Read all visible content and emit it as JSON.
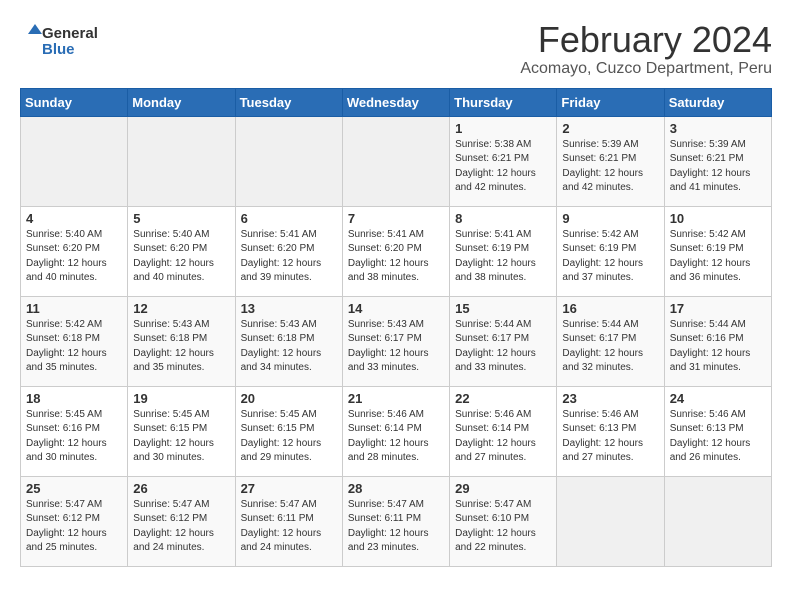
{
  "header": {
    "logo_general": "General",
    "logo_blue": "Blue",
    "title": "February 2024",
    "subtitle": "Acomayo, Cuzco Department, Peru"
  },
  "weekdays": [
    "Sunday",
    "Monday",
    "Tuesday",
    "Wednesday",
    "Thursday",
    "Friday",
    "Saturday"
  ],
  "weeks": [
    [
      {
        "day": "",
        "sunrise": "",
        "sunset": "",
        "daylight": ""
      },
      {
        "day": "",
        "sunrise": "",
        "sunset": "",
        "daylight": ""
      },
      {
        "day": "",
        "sunrise": "",
        "sunset": "",
        "daylight": ""
      },
      {
        "day": "",
        "sunrise": "",
        "sunset": "",
        "daylight": ""
      },
      {
        "day": "1",
        "sunrise": "5:38 AM",
        "sunset": "6:21 PM",
        "daylight": "12 hours and 42 minutes."
      },
      {
        "day": "2",
        "sunrise": "5:39 AM",
        "sunset": "6:21 PM",
        "daylight": "12 hours and 42 minutes."
      },
      {
        "day": "3",
        "sunrise": "5:39 AM",
        "sunset": "6:21 PM",
        "daylight": "12 hours and 41 minutes."
      }
    ],
    [
      {
        "day": "4",
        "sunrise": "5:40 AM",
        "sunset": "6:20 PM",
        "daylight": "12 hours and 40 minutes."
      },
      {
        "day": "5",
        "sunrise": "5:40 AM",
        "sunset": "6:20 PM",
        "daylight": "12 hours and 40 minutes."
      },
      {
        "day": "6",
        "sunrise": "5:41 AM",
        "sunset": "6:20 PM",
        "daylight": "12 hours and 39 minutes."
      },
      {
        "day": "7",
        "sunrise": "5:41 AM",
        "sunset": "6:20 PM",
        "daylight": "12 hours and 38 minutes."
      },
      {
        "day": "8",
        "sunrise": "5:41 AM",
        "sunset": "6:19 PM",
        "daylight": "12 hours and 38 minutes."
      },
      {
        "day": "9",
        "sunrise": "5:42 AM",
        "sunset": "6:19 PM",
        "daylight": "12 hours and 37 minutes."
      },
      {
        "day": "10",
        "sunrise": "5:42 AM",
        "sunset": "6:19 PM",
        "daylight": "12 hours and 36 minutes."
      }
    ],
    [
      {
        "day": "11",
        "sunrise": "5:42 AM",
        "sunset": "6:18 PM",
        "daylight": "12 hours and 35 minutes."
      },
      {
        "day": "12",
        "sunrise": "5:43 AM",
        "sunset": "6:18 PM",
        "daylight": "12 hours and 35 minutes."
      },
      {
        "day": "13",
        "sunrise": "5:43 AM",
        "sunset": "6:18 PM",
        "daylight": "12 hours and 34 minutes."
      },
      {
        "day": "14",
        "sunrise": "5:43 AM",
        "sunset": "6:17 PM",
        "daylight": "12 hours and 33 minutes."
      },
      {
        "day": "15",
        "sunrise": "5:44 AM",
        "sunset": "6:17 PM",
        "daylight": "12 hours and 33 minutes."
      },
      {
        "day": "16",
        "sunrise": "5:44 AM",
        "sunset": "6:17 PM",
        "daylight": "12 hours and 32 minutes."
      },
      {
        "day": "17",
        "sunrise": "5:44 AM",
        "sunset": "6:16 PM",
        "daylight": "12 hours and 31 minutes."
      }
    ],
    [
      {
        "day": "18",
        "sunrise": "5:45 AM",
        "sunset": "6:16 PM",
        "daylight": "12 hours and 30 minutes."
      },
      {
        "day": "19",
        "sunrise": "5:45 AM",
        "sunset": "6:15 PM",
        "daylight": "12 hours and 30 minutes."
      },
      {
        "day": "20",
        "sunrise": "5:45 AM",
        "sunset": "6:15 PM",
        "daylight": "12 hours and 29 minutes."
      },
      {
        "day": "21",
        "sunrise": "5:46 AM",
        "sunset": "6:14 PM",
        "daylight": "12 hours and 28 minutes."
      },
      {
        "day": "22",
        "sunrise": "5:46 AM",
        "sunset": "6:14 PM",
        "daylight": "12 hours and 27 minutes."
      },
      {
        "day": "23",
        "sunrise": "5:46 AM",
        "sunset": "6:13 PM",
        "daylight": "12 hours and 27 minutes."
      },
      {
        "day": "24",
        "sunrise": "5:46 AM",
        "sunset": "6:13 PM",
        "daylight": "12 hours and 26 minutes."
      }
    ],
    [
      {
        "day": "25",
        "sunrise": "5:47 AM",
        "sunset": "6:12 PM",
        "daylight": "12 hours and 25 minutes."
      },
      {
        "day": "26",
        "sunrise": "5:47 AM",
        "sunset": "6:12 PM",
        "daylight": "12 hours and 24 minutes."
      },
      {
        "day": "27",
        "sunrise": "5:47 AM",
        "sunset": "6:11 PM",
        "daylight": "12 hours and 24 minutes."
      },
      {
        "day": "28",
        "sunrise": "5:47 AM",
        "sunset": "6:11 PM",
        "daylight": "12 hours and 23 minutes."
      },
      {
        "day": "29",
        "sunrise": "5:47 AM",
        "sunset": "6:10 PM",
        "daylight": "12 hours and 22 minutes."
      },
      {
        "day": "",
        "sunrise": "",
        "sunset": "",
        "daylight": ""
      },
      {
        "day": "",
        "sunrise": "",
        "sunset": "",
        "daylight": ""
      }
    ]
  ]
}
